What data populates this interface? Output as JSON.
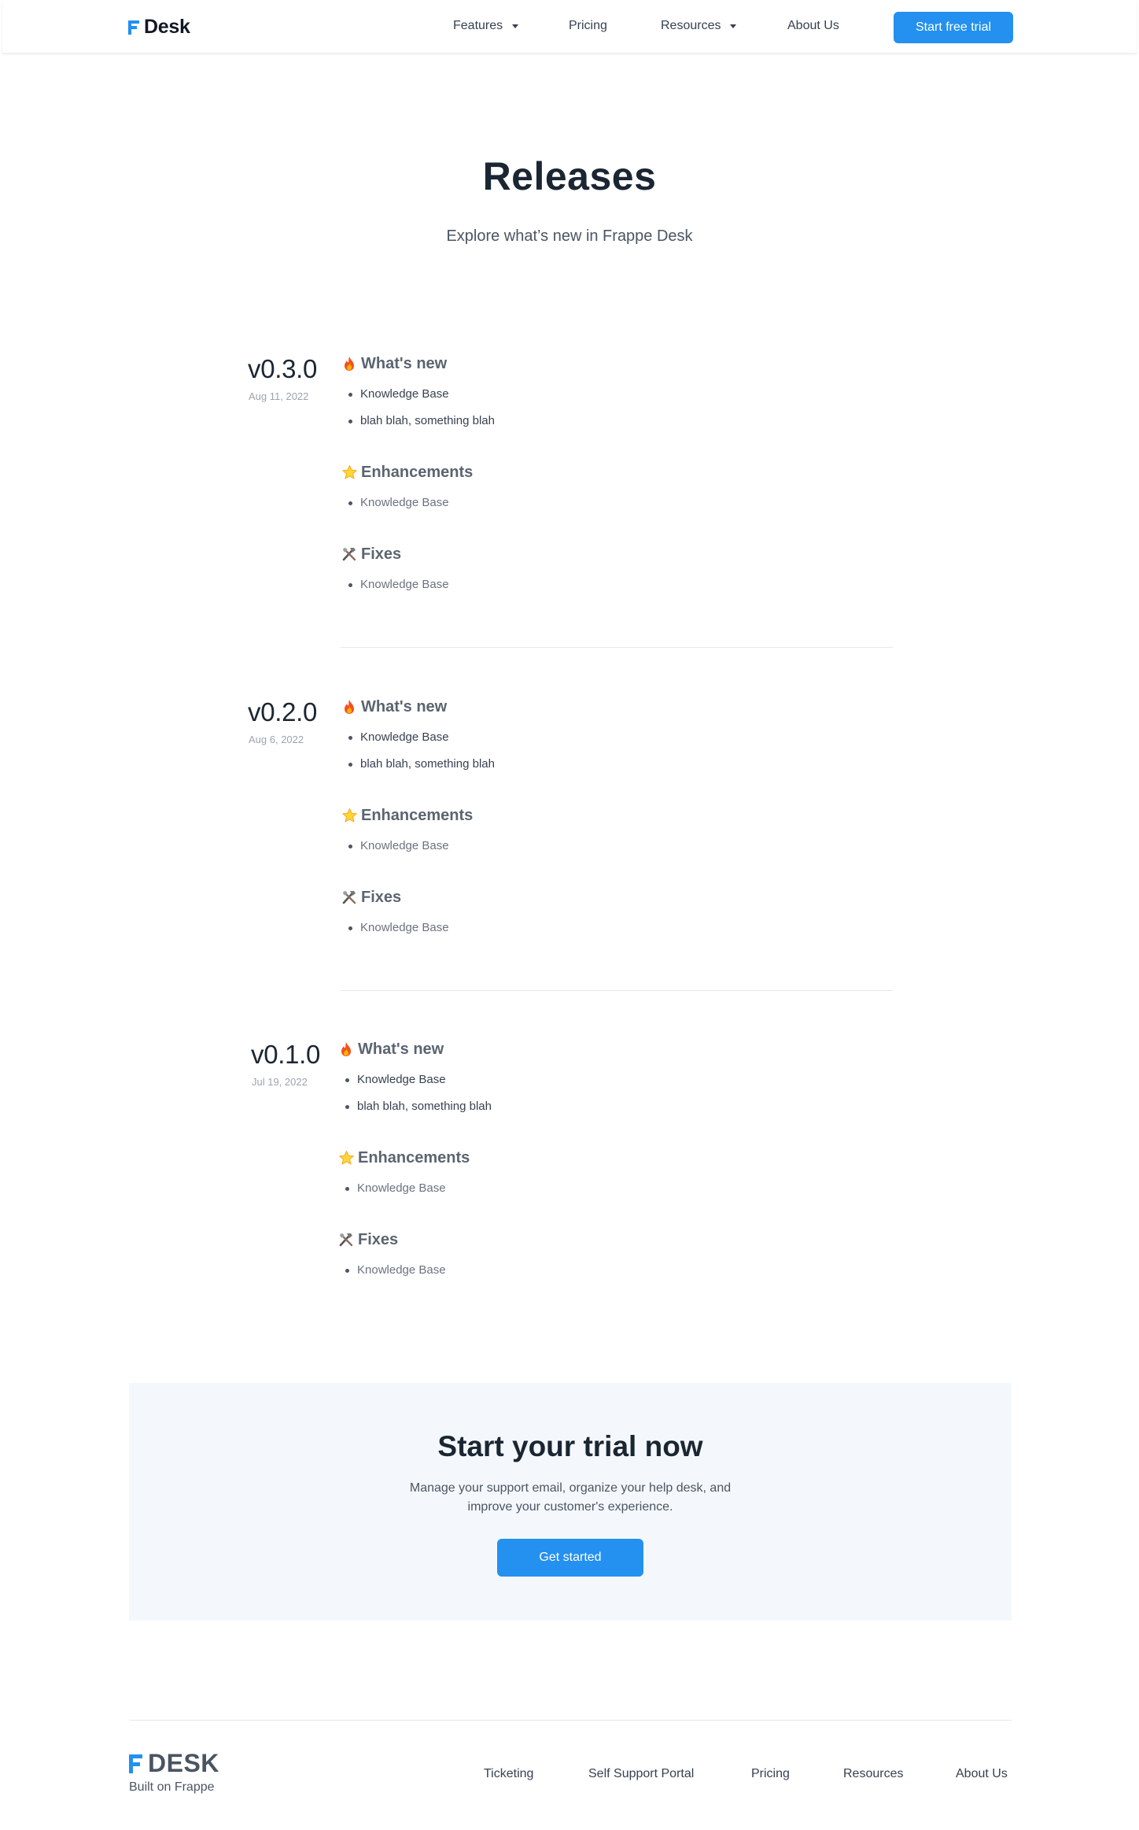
{
  "header": {
    "brand": "Desk",
    "nav": {
      "features": "Features",
      "pricing": "Pricing",
      "resources": "Resources",
      "about": "About Us"
    },
    "cta": "Start free trial"
  },
  "hero": {
    "title": "Releases",
    "subtitle": "Explore what’s new in Frappe Desk"
  },
  "releases": [
    {
      "version": "v0.3.0",
      "date": "Aug 11, 2022",
      "whats_new": {
        "heading": "What's new",
        "items": [
          "Knowledge Base",
          "blah blah, something blah"
        ]
      },
      "enhancements": {
        "heading": "Enhancements",
        "items": [
          "Knowledge Base"
        ]
      },
      "fixes": {
        "heading": "Fixes",
        "items": [
          "Knowledge Base"
        ]
      }
    },
    {
      "version": "v0.2.0",
      "date": "Aug 6, 2022",
      "whats_new": {
        "heading": "What's new",
        "items": [
          "Knowledge Base",
          "blah blah, something blah"
        ]
      },
      "enhancements": {
        "heading": "Enhancements",
        "items": [
          "Knowledge Base"
        ]
      },
      "fixes": {
        "heading": "Fixes",
        "items": [
          "Knowledge Base"
        ]
      }
    },
    {
      "version": "v0.1.0",
      "date": "Jul 19, 2022",
      "whats_new": {
        "heading": "What's new",
        "items": [
          "Knowledge Base",
          "blah blah, something blah"
        ]
      },
      "enhancements": {
        "heading": "Enhancements",
        "items": [
          "Knowledge Base"
        ]
      },
      "fixes": {
        "heading": "Fixes",
        "items": [
          "Knowledge Base"
        ]
      }
    }
  ],
  "icons": {
    "whats_new": "fire-icon",
    "enhancements": "star-icon",
    "fixes": "tools-icon"
  },
  "trial": {
    "title": "Start your trial now",
    "description_line1": "Manage your support email, organize your help desk, and",
    "description_line2": "improve your customer's experience.",
    "button": "Get started"
  },
  "footer": {
    "brand": "DESK",
    "tagline": "Built on Frappe",
    "links": {
      "ticketing": "Ticketing",
      "portal": "Self Support Portal",
      "pricing": "Pricing",
      "resources": "Resources",
      "about": "About Us"
    }
  },
  "colors": {
    "accent": "#2490ef",
    "heading": "#1b2633",
    "muted": "#9ca3af",
    "cta_background": "#f4f8fc"
  }
}
